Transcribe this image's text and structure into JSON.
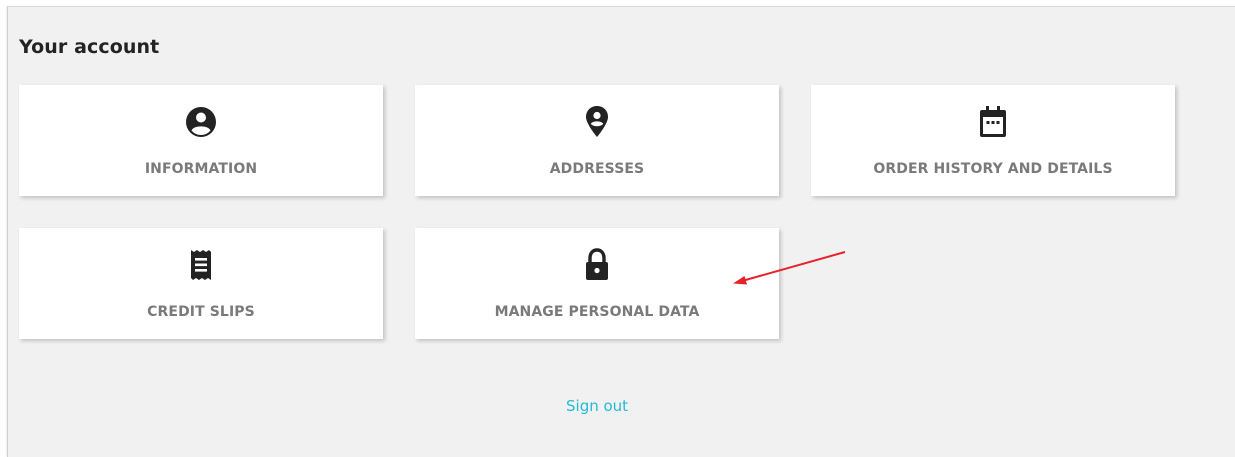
{
  "page": {
    "title": "Your account",
    "signout_label": "Sign out",
    "accent_color": "#25b9d7",
    "annotation_color": "#e8202a"
  },
  "cards": [
    {
      "label": "INFORMATION",
      "icon": "account-circle-icon"
    },
    {
      "label": "ADDRESSES",
      "icon": "location-pin-icon"
    },
    {
      "label": "ORDER HISTORY AND DETAILS",
      "icon": "calendar-icon"
    },
    {
      "label": "CREDIT SLIPS",
      "icon": "receipt-icon"
    },
    {
      "label": "MANAGE PERSONAL DATA",
      "icon": "lock-icon"
    }
  ]
}
